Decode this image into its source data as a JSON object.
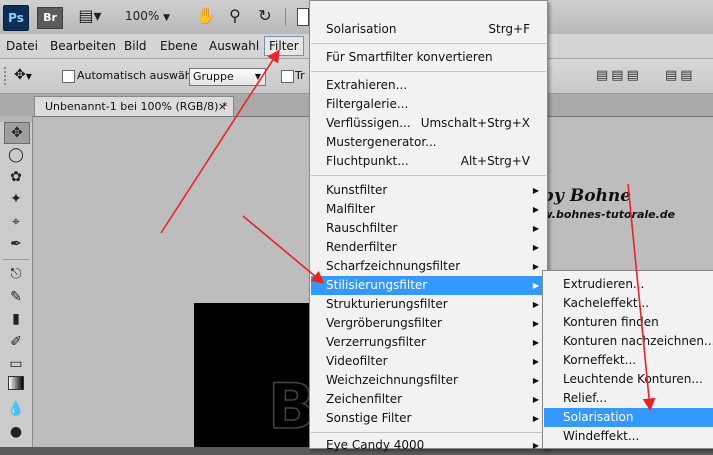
{
  "app": {
    "logo": "Ps",
    "bridge": "Br",
    "zoom": "100%"
  },
  "menubar": [
    "Datei",
    "Bearbeiten",
    "Bild",
    "Ebene",
    "Auswahl",
    "Filter"
  ],
  "options": {
    "auto_select_label": "Automatisch auswählen:",
    "group_value": "Gruppe",
    "truncated_label": "Tr"
  },
  "document_tab": {
    "title": "Unbenannt-1 bei 100% (RGB/8) *",
    "close": "×"
  },
  "canvas": {
    "letter": "B"
  },
  "watermark": {
    "line1": "by Bohne",
    "line2": "www.bohnes-tutorale.de"
  },
  "filter_menu": {
    "items": [
      {
        "label": "Solarisation",
        "shortcut": "Strg+F"
      },
      {
        "label": "Für Smartfilter konvertieren"
      },
      {
        "label": "Extrahieren..."
      },
      {
        "label": "Filtergalerie..."
      },
      {
        "label": "Verflüssigen...",
        "shortcut": "Umschalt+Strg+X"
      },
      {
        "label": "Mustergenerator..."
      },
      {
        "label": "Fluchtpunkt...",
        "shortcut": "Alt+Strg+V"
      },
      {
        "label": "Kunstfilter"
      },
      {
        "label": "Malfilter"
      },
      {
        "label": "Rauschfilter"
      },
      {
        "label": "Renderfilter"
      },
      {
        "label": "Scharfzeichnungsfilter"
      },
      {
        "label": "Stilisierungsfilter"
      },
      {
        "label": "Strukturierungsfilter"
      },
      {
        "label": "Vergröberungsfilter"
      },
      {
        "label": "Verzerrungsfilter"
      },
      {
        "label": "Videofilter"
      },
      {
        "label": "Weichzeichnungsfilter"
      },
      {
        "label": "Zeichenfilter"
      },
      {
        "label": "Sonstige Filter"
      },
      {
        "label": "Eye Candy 4000"
      }
    ]
  },
  "submenu": {
    "items": [
      {
        "label": "Extrudieren..."
      },
      {
        "label": "Kacheleffekt..."
      },
      {
        "label": "Konturen finden"
      },
      {
        "label": "Konturen nachzeichnen..."
      },
      {
        "label": "Korneffekt..."
      },
      {
        "label": "Leuchtende Konturen..."
      },
      {
        "label": "Relief..."
      },
      {
        "label": "Solarisation"
      },
      {
        "label": "Windeffekt..."
      }
    ]
  },
  "colors": {
    "highlight": "#3399ff",
    "arrow": "#e8242a"
  }
}
